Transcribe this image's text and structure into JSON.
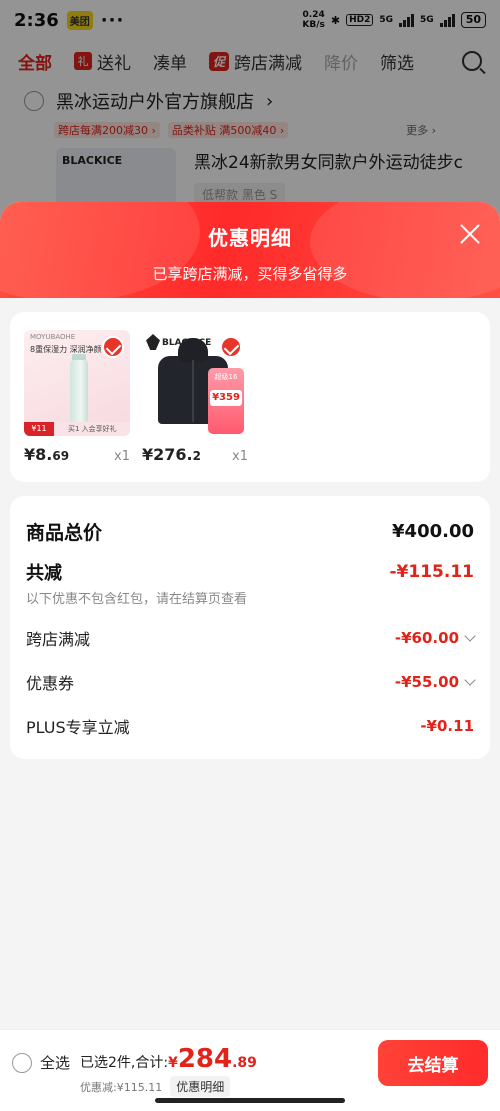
{
  "status_bar": {
    "time": "2:36",
    "app_badge": "美团",
    "dots": "···",
    "speed_value": "0.24",
    "speed_unit": "KB/s",
    "hd_label": "HD2",
    "net1": "5G",
    "net2": "5G",
    "battery": "50"
  },
  "filter_tabs": [
    {
      "label": "全部",
      "active": true
    },
    {
      "label": "送礼"
    },
    {
      "label": "凑单"
    },
    {
      "label": "跨店满减",
      "icon_text": "促"
    },
    {
      "label": "降价",
      "muted": true
    },
    {
      "label": "筛选"
    }
  ],
  "store": {
    "name": "黑冰运动户外官方旗舰店",
    "promo_chips": [
      "跨店每满200减30 ›",
      "品类补贴 满500减40 ›"
    ],
    "more": "更多 ›",
    "brand_mark": "BLACKICE",
    "product_title": "黑冰24新款男女同款户外运动徒步c",
    "product_sub": "低帮款 黑色 S"
  },
  "sheet": {
    "title": "优惠明细",
    "subtitle": "已享跨店满减，买得多省得多"
  },
  "items": [
    {
      "name": "cream",
      "brand": "MOYUBAOHE",
      "slogan": "8重保湿力 深润净颜",
      "tag": "¥11",
      "foot": "买1 入会享好礼",
      "price_int": "¥8.",
      "price_dec": "69",
      "qty": "x1"
    },
    {
      "name": "jacket",
      "logo_text": "BLACKICE",
      "badge_text": "超级16",
      "badge_price": "¥359",
      "price_int": "¥276.",
      "price_dec": "2",
      "qty": "x1"
    }
  ],
  "summary": {
    "total_label": "商品总价",
    "total_value": "¥400.00",
    "reduce_label": "共减",
    "reduce_value": "-¥115.11",
    "note": "以下优惠不包含红包，请在结算页查看",
    "lines": [
      {
        "label": "跨店满减",
        "value": "-¥60.00",
        "expandable": true
      },
      {
        "label": "优惠券",
        "value": "-¥55.00",
        "expandable": true
      },
      {
        "label": "PLUS专享立减",
        "value": "-¥0.11",
        "expandable": false
      }
    ]
  },
  "bottom_bar": {
    "select_all": "全选",
    "sum_prefix": "已选2件,合计:",
    "currency": "¥",
    "sum_big": "284",
    "sum_small": ".89",
    "discount_text": "优惠减:¥115.11",
    "detail_label": "优惠明细",
    "checkout_label": "去结算"
  },
  "colors": {
    "brand_red": "#e2231a",
    "header_gradient_start": "#ff4d3d",
    "header_gradient_end": "#ff2a2a"
  }
}
